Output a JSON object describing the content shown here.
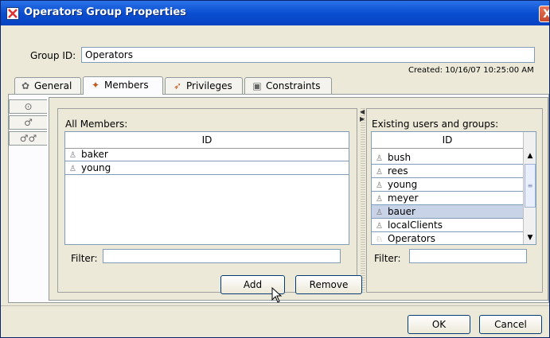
{
  "window": {
    "title": "Operators Group Properties",
    "close_label": "X"
  },
  "group": {
    "id_label": "Group ID:",
    "id_value": "Operators",
    "created_text": "Created: 10/16/07 10:25:00 AM"
  },
  "tabs": [
    {
      "label": "General",
      "icon": "gear-icon"
    },
    {
      "label": "Members",
      "icon": "members-icon"
    },
    {
      "label": "Privileges",
      "icon": "privileges-icon"
    },
    {
      "label": "Constraints",
      "icon": "constraints-icon"
    }
  ],
  "side_tabs": [
    {
      "icon": "circle-check-icon",
      "glyph": "⊙"
    },
    {
      "icon": "user-icon",
      "glyph": "♂"
    },
    {
      "icon": "users-icon",
      "glyph": "♂♂"
    }
  ],
  "members": {
    "title": "All Members:",
    "column": "ID",
    "rows": [
      "baker",
      "young"
    ],
    "filter_label": "Filter:",
    "filter_value": ""
  },
  "existing": {
    "title": "Existing users and groups:",
    "column": "ID",
    "rows": [
      "bush",
      "rees",
      "young",
      "meyer",
      "bauer",
      "localClients",
      "Operators"
    ],
    "selected": "bauer",
    "filter_label": "Filter:",
    "filter_value": ""
  },
  "actions": {
    "add": "Add",
    "remove": "Remove"
  },
  "footer": {
    "ok": "OK",
    "cancel": "Cancel"
  },
  "colors": {
    "titlebar": "#0a4fd0",
    "selection": "#c9d3e8",
    "panel": "#ece9d8"
  }
}
